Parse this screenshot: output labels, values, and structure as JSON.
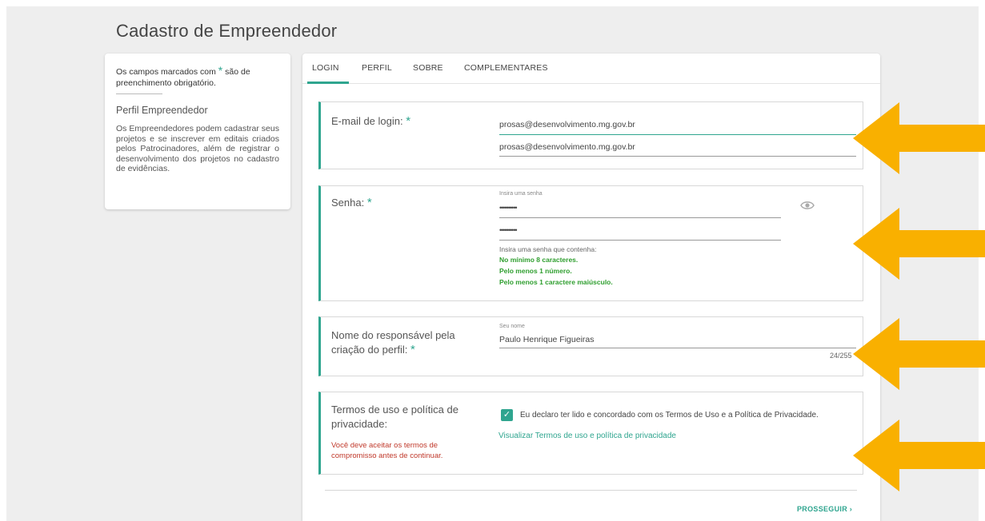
{
  "page": {
    "title": "Cadastro de Empreendedor"
  },
  "left_panel": {
    "required_note_part1": "Os campos marcados com",
    "required_star": "*",
    "required_note_part2": "são de preenchimento obrigatório.",
    "profile_title": "Perfil Empreendedor",
    "profile_description": "Os Empreendedores podem cadastrar seus projetos e se inscrever em editais criados pelos Patrocinadores, além de registrar o desenvolvimento dos projetos no cadastro de evidências."
  },
  "tabs": [
    {
      "label": "LOGIN",
      "active": true
    },
    {
      "label": "PERFIL",
      "active": false
    },
    {
      "label": "SOBRE",
      "active": false
    },
    {
      "label": "COMPLEMENTARES",
      "active": false
    }
  ],
  "email_section": {
    "label": "E-mail de login:",
    "star": "*",
    "email_value": "prosas@desenvolvimento.mg.gov.br",
    "confirm_value": "prosas@desenvolvimento.mg.gov.br"
  },
  "password_section": {
    "label": "Senha:",
    "star": "*",
    "field_label": "Insira uma senha",
    "password_value": "••••••••••",
    "confirm_value": "••••••••••",
    "eye_icon": "eye-icon",
    "hint_title": "Insira uma senha que contenha:",
    "rules": [
      "No mínimo 8 caracteres.",
      "Pelo menos 1 número.",
      "Pelo menos 1 caractere maiúsculo."
    ],
    "rule_color": "#2e9e2e"
  },
  "name_section": {
    "label_line1": "Nome do responsável pela",
    "label_line2": "criação do perfil:",
    "star": "*",
    "field_label": "Seu nome",
    "value": "Paulo Henrique Figueiras",
    "counter": "24/255"
  },
  "terms_section": {
    "label_line1": "Termos de uso e política de",
    "label_line2": "privacidade:",
    "error_line1": "Você deve aceitar os termos de",
    "error_line2": "compromisso antes de continuar.",
    "checkbox_checked": true,
    "checkbox_mark": "✓",
    "declaration": "Eu declaro ter lido e concordado com os Termos de Uso e a Política de Privacidade.",
    "link": "Visualizar Termos de uso e política de privacidade"
  },
  "footer": {
    "next_label": "PROSSEGUIR ›"
  },
  "colors": {
    "accent": "#2fa58f",
    "arrow": "#f9b000",
    "error": "#c0392b"
  }
}
